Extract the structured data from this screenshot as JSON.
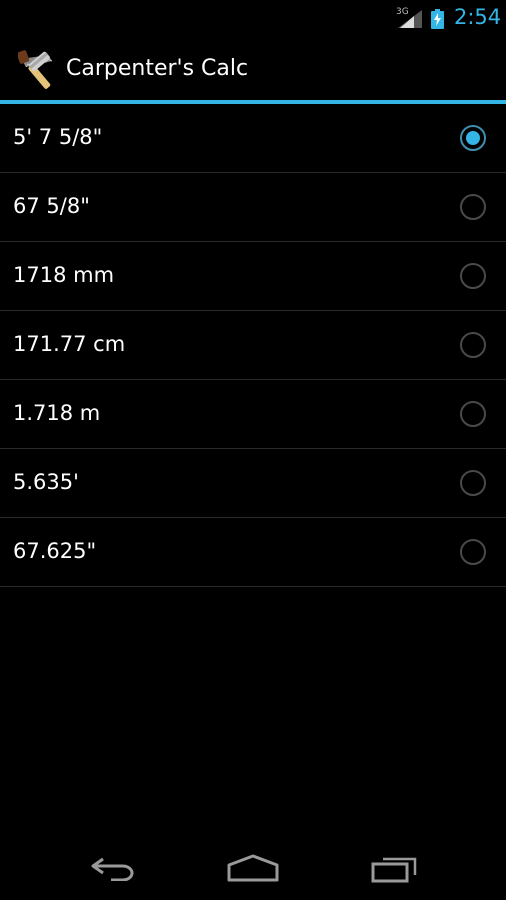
{
  "status_bar": {
    "network_type": "3G",
    "time": "2:54",
    "accent_color": "#33b5e5"
  },
  "action_bar": {
    "title": "Carpenter's Calc",
    "icon": "carpenter-tools-icon"
  },
  "conversions": [
    {
      "label": "5' 7 5/8\"",
      "selected": true
    },
    {
      "label": "67 5/8\"",
      "selected": false
    },
    {
      "label": "1718 mm",
      "selected": false
    },
    {
      "label": "171.77 cm",
      "selected": false
    },
    {
      "label": "1.718 m",
      "selected": false
    },
    {
      "label": "5.635'",
      "selected": false
    },
    {
      "label": "67.625\"",
      "selected": false
    }
  ],
  "nav_bar": {
    "icons": [
      "back-icon",
      "home-icon",
      "recent-apps-icon"
    ]
  }
}
